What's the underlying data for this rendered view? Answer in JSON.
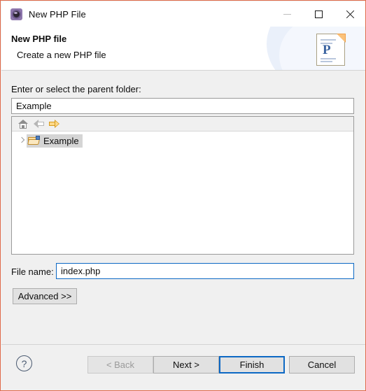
{
  "window": {
    "title": "New PHP File",
    "icon": "gear-icon",
    "border_color": "#e06a4a",
    "controls": {
      "minimize": "minimize-icon",
      "maximize": "maximize-icon",
      "close": "close-icon"
    }
  },
  "header": {
    "title": "New PHP file",
    "subtitle": "Create a new PHP file",
    "icon": "php-document-icon",
    "icon_letter": "P"
  },
  "body": {
    "parent_folder_label": "Enter or select the parent folder:",
    "parent_folder_value": "Example",
    "parent_folder_placeholder": "",
    "tree_toolbar": [
      {
        "name": "home-icon",
        "enabled": true
      },
      {
        "name": "back-arrow-icon",
        "enabled": false
      },
      {
        "name": "forward-arrow-icon",
        "enabled": true
      }
    ],
    "tree_items": [
      {
        "label": "Example",
        "icon": "php-folder-icon",
        "selected": true,
        "expandable": true
      }
    ],
    "file_name_label": "File name:",
    "file_name_value": "index.php",
    "file_name_placeholder": "",
    "advanced_label": "Advanced >>"
  },
  "footer": {
    "help_label": "?",
    "buttons": [
      {
        "label": "< Back",
        "enabled": false,
        "default": false
      },
      {
        "label": "Next >",
        "enabled": true,
        "default": false
      },
      {
        "label": "Finish",
        "enabled": true,
        "default": true
      },
      {
        "label": "Cancel",
        "enabled": true,
        "default": false
      }
    ]
  },
  "colors": {
    "accent": "#0c68c4",
    "window_border": "#e06a4a",
    "dialog_bg": "#f0f0f0",
    "selection": "#d5d5d5"
  }
}
